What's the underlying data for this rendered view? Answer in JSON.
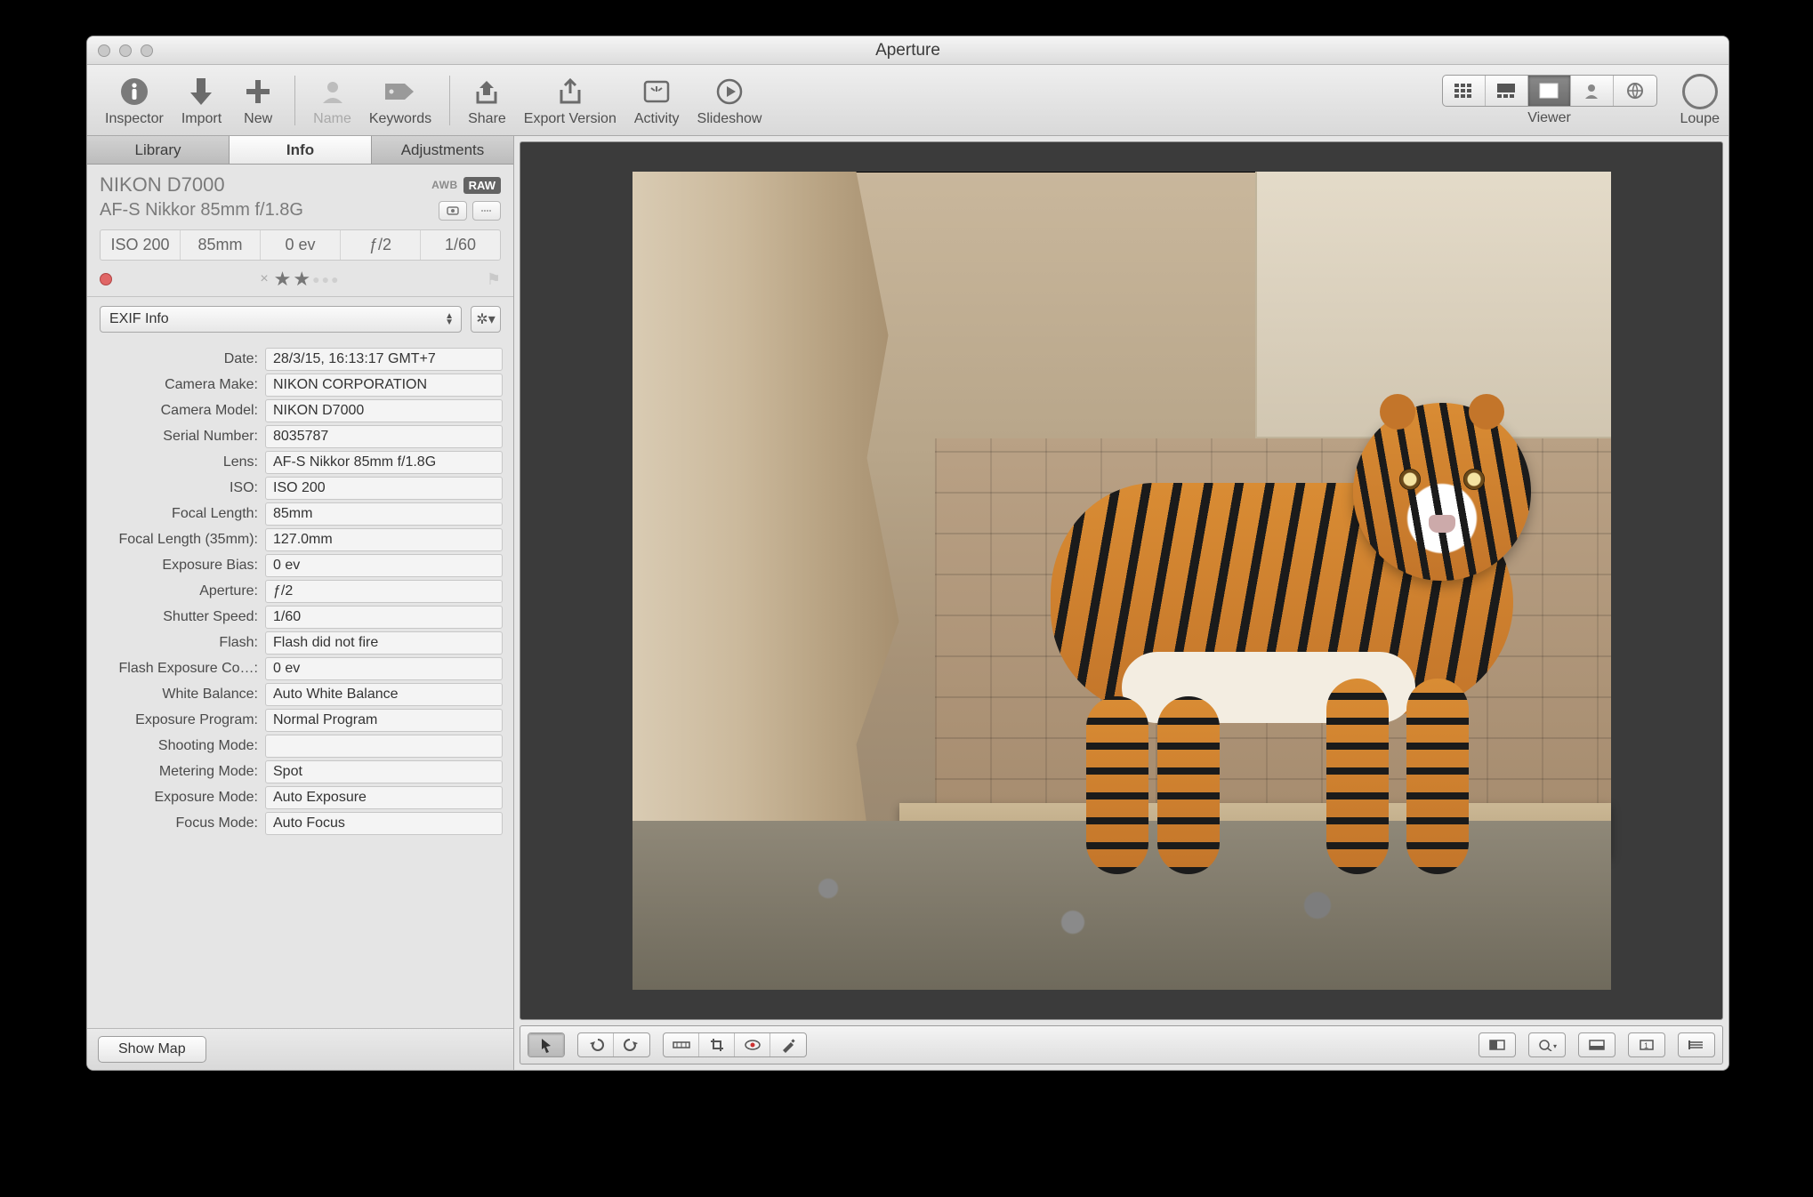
{
  "window": {
    "title": "Aperture"
  },
  "toolbar": {
    "inspector": "Inspector",
    "import": "Import",
    "new": "New",
    "name": "Name",
    "keywords": "Keywords",
    "share": "Share",
    "export": "Export Version",
    "activity": "Activity",
    "slideshow": "Slideshow",
    "viewer": "Viewer",
    "loupe": "Loupe"
  },
  "inspector": {
    "tabs": {
      "library": "Library",
      "info": "Info",
      "adjustments": "Adjustments"
    },
    "camera": "NIKON D7000",
    "awb": "AWB",
    "raw": "RAW",
    "lens": "AF-S Nikkor 85mm f/1.8G",
    "strip": {
      "iso": "ISO 200",
      "focal": "85mm",
      "ev": "0 ev",
      "fstop": "ƒ/2",
      "shutter": "1/60"
    },
    "preset": "EXIF Info",
    "exif_rows": [
      {
        "k": "Date:",
        "v": "28/3/15, 16:13:17 GMT+7"
      },
      {
        "k": "Camera Make:",
        "v": "NIKON CORPORATION"
      },
      {
        "k": "Camera Model:",
        "v": "NIKON D7000"
      },
      {
        "k": "Serial Number:",
        "v": "8035787"
      },
      {
        "k": "Lens:",
        "v": "AF-S Nikkor 85mm f/1.8G"
      },
      {
        "k": "ISO:",
        "v": "ISO 200"
      },
      {
        "k": "Focal Length:",
        "v": "85mm"
      },
      {
        "k": "Focal Length (35mm):",
        "v": "127.0mm"
      },
      {
        "k": "Exposure Bias:",
        "v": "0 ev"
      },
      {
        "k": "Aperture:",
        "v": "ƒ/2"
      },
      {
        "k": "Shutter Speed:",
        "v": "1/60"
      },
      {
        "k": "Flash:",
        "v": "Flash did not fire"
      },
      {
        "k": "Flash Exposure Co…:",
        "v": "0 ev"
      },
      {
        "k": "White Balance:",
        "v": "Auto White Balance"
      },
      {
        "k": "Exposure Program:",
        "v": "Normal Program"
      },
      {
        "k": "Shooting Mode:",
        "v": ""
      },
      {
        "k": "Metering Mode:",
        "v": "Spot"
      },
      {
        "k": "Exposure Mode:",
        "v": "Auto Exposure"
      },
      {
        "k": "Focus Mode:",
        "v": "Auto Focus"
      }
    ],
    "show_map": "Show Map"
  }
}
